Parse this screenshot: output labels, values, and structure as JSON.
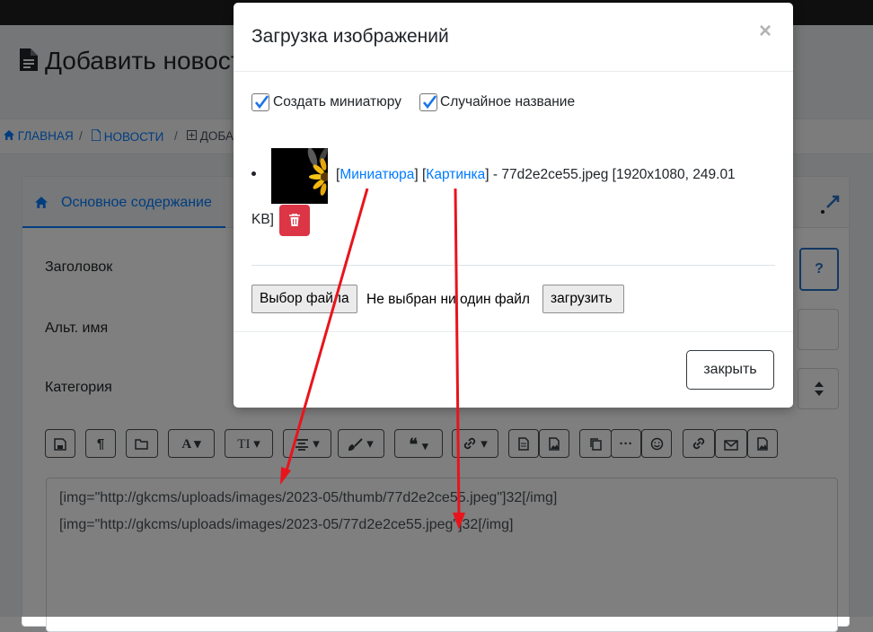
{
  "page": {
    "title": "Добавить новост",
    "breadcrumb": {
      "home": "ГЛАВНАЯ",
      "news": "НОВОСТИ",
      "current": "ДОБА",
      "sep": "/"
    },
    "tabs": {
      "main": "Основное содержание"
    },
    "form": {
      "title_label": "Заголовок",
      "alias_label": "Альт. имя",
      "category_label": "Категория",
      "help_label": "?"
    },
    "editor": {
      "lines": [
        "[img=\"http://gkcms/uploads/images/2023-05/thumb/77d2e2ce55.jpeg\"]32[/img]",
        "[img=\"http://gkcms/uploads/images/2023-05/77d2e2ce55.jpeg\"]32[/img]"
      ]
    }
  },
  "modal": {
    "title": "Загрузка изображений",
    "close_symbol": "×",
    "options": {
      "create_thumbnail": "Создать миниатюру",
      "random_name": "Случайное название"
    },
    "file": {
      "thumb_link": "Миниатюра",
      "image_link": "Картинка",
      "info": "- 77d2e2ce55.jpeg [1920x1080, 249.01",
      "info_end": "KB]",
      "bracket_open": "[",
      "bracket_close": "]"
    },
    "choose_file": "Выбор файла",
    "no_file": "Не выбран ни один файл",
    "upload": "загрузить",
    "close": "закрыть"
  },
  "colors": {
    "accent": "#007bff",
    "danger": "#dc3545",
    "arrow": "#e8141c"
  }
}
